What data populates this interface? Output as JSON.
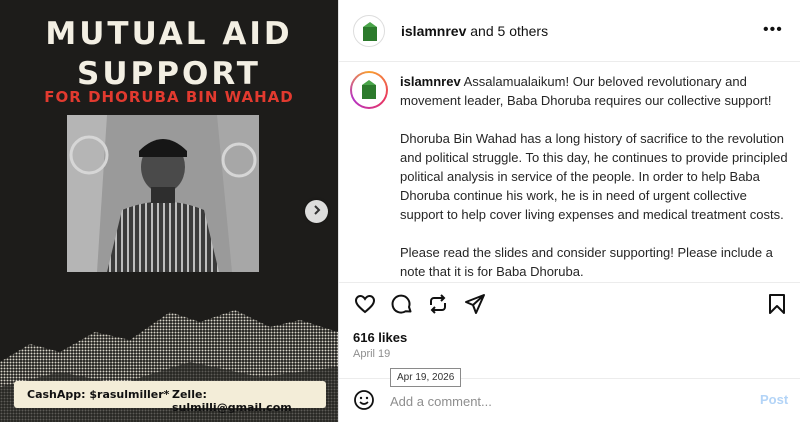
{
  "poster": {
    "title_line1": "MUTUAL AID",
    "title_line2": "SUPPORT",
    "subtitle": "FOR DHORUBA BIN WAHAD",
    "cashapp": "CashApp: $rasulmiller*",
    "zelle": "Zelle: sulmilli@gmail.com"
  },
  "header": {
    "username": "islamnrev",
    "others": " and 5 others",
    "more_label": "•••"
  },
  "caption": {
    "username": "islamnrev",
    "paragraph1": " Assalamualaikum! Our beloved revolutionary and movement leader, Baba Dhoruba requires our collective support!",
    "paragraph2": "Dhoruba Bin Wahad has a long history of sacrifice to the revolution and political struggle. To this day, he continues to provide principled political analysis in service of the people. In order to help Baba Dhoruba continue his work, he is in need of urgent collective support to help cover living expenses and medical treatment costs.",
    "paragraph3": "Please read the slides and consider supporting! Please include a note that it is for Baba Dhoruba."
  },
  "stats": {
    "likes": "616 likes",
    "date": "April 19",
    "tooltip": "Apr 19, 2026"
  },
  "comment": {
    "placeholder": "Add a comment...",
    "post_label": "Post"
  },
  "icons": {
    "like": "heart-icon",
    "comment": "comment-bubble-icon",
    "repost": "repost-icon",
    "share": "send-icon",
    "save": "bookmark-icon",
    "emoji": "smiley-icon",
    "next": "chevron-right-icon"
  },
  "colors": {
    "poster_bg": "#1d1c1a",
    "poster_title": "#f3efe3",
    "poster_subtitle": "#e23a2f",
    "post_button": "#b3d4f7"
  }
}
